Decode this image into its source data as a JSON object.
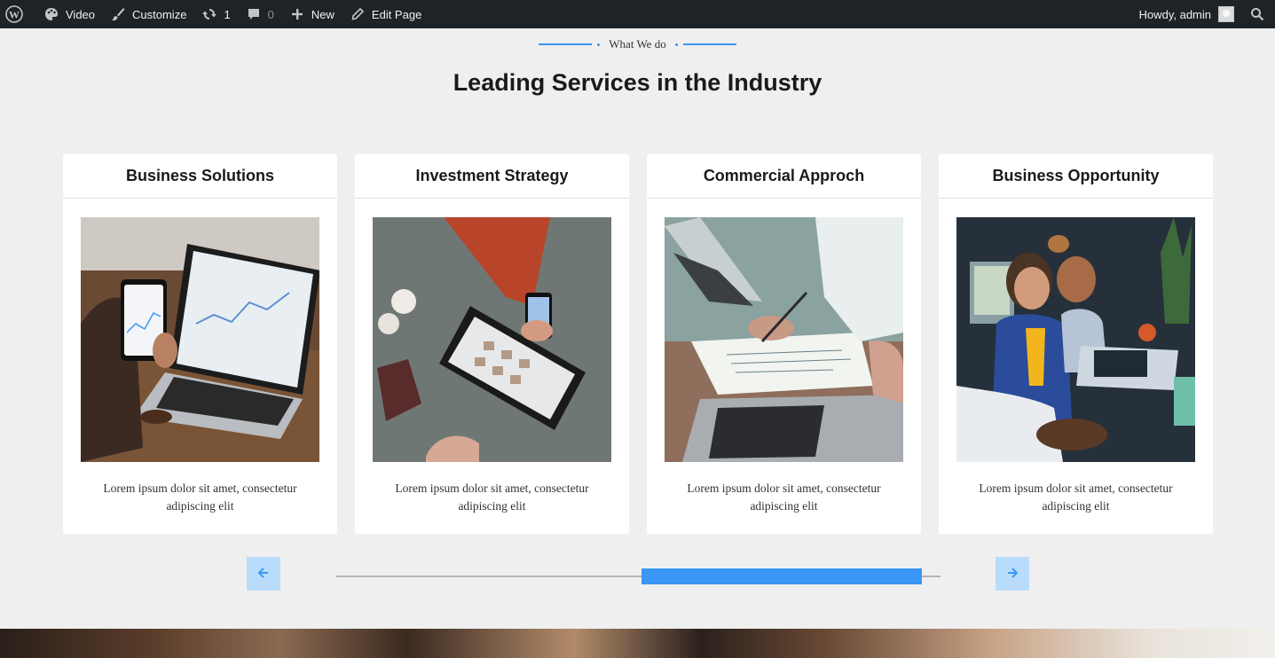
{
  "adminbar": {
    "items": [
      {
        "icon": "wordpress-icon",
        "label": ""
      },
      {
        "icon": "palette-icon",
        "label": "Video"
      },
      {
        "icon": "brush-icon",
        "label": "Customize"
      },
      {
        "icon": "updates-icon",
        "label": "1"
      },
      {
        "icon": "comment-icon",
        "label": "0"
      },
      {
        "icon": "plus-icon",
        "label": "New"
      },
      {
        "icon": "pencil-icon",
        "label": "Edit Page"
      }
    ],
    "greeting": "Howdy, admin",
    "search_icon": "search-icon"
  },
  "section": {
    "eyebrow": "What We do",
    "title": "Leading Services in the Industry"
  },
  "cards": [
    {
      "title": "Business Solutions",
      "desc": "Lorem ipsum dolor sit amet, consectetur adipiscing elit"
    },
    {
      "title": "Investment Strategy",
      "desc": "Lorem ipsum dolor sit amet, consectetur adipiscing elit"
    },
    {
      "title": "Commercial Approch",
      "desc": "Lorem ipsum dolor sit amet, consectetur adipiscing elit"
    },
    {
      "title": "Business Opportunity",
      "desc": "Lorem ipsum dolor sit amet, consectetur adipiscing elit"
    }
  ],
  "slider": {
    "prev_icon": "arrow-left-icon",
    "next_icon": "arrow-right-icon"
  },
  "colors": {
    "accent": "#3a97f5",
    "adminbar_bg": "#1d2327",
    "page_bg": "#efefef"
  }
}
